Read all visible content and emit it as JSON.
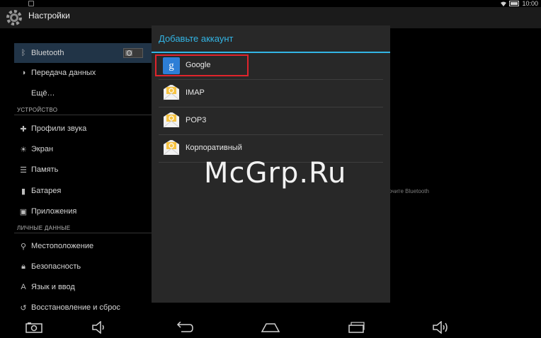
{
  "status_bar": {
    "time": "10:00"
  },
  "app": {
    "title": "Настройки"
  },
  "sidebar": {
    "items": [
      {
        "label": "Bluetooth",
        "icon": "bluetooth-icon",
        "selected": true
      },
      {
        "label": "Передача данных",
        "icon": "data-usage-icon"
      },
      {
        "label": "Ещё…",
        "icon": ""
      },
      {
        "label": "Профили звука",
        "icon": "sound-profile-icon"
      },
      {
        "label": "Экран",
        "icon": "display-icon"
      },
      {
        "label": "Память",
        "icon": "storage-icon"
      },
      {
        "label": "Батарея",
        "icon": "battery-icon"
      },
      {
        "label": "Приложения",
        "icon": "apps-icon"
      },
      {
        "label": "Местоположение",
        "icon": "location-icon"
      },
      {
        "label": "Безопасность",
        "icon": "lock-icon"
      },
      {
        "label": "Язык и ввод",
        "icon": "language-icon"
      },
      {
        "label": "Восстановление и сброс",
        "icon": "restore-icon"
      }
    ],
    "sections": {
      "device": "УСТРОЙСТВО",
      "personal": "ЛИЧНЫЕ ДАННЫЕ"
    }
  },
  "detail": {
    "hint": "очите Bluetooth"
  },
  "dialog": {
    "title": "Добавьте аккаунт",
    "accounts": [
      {
        "label": "Google",
        "icon": "google-icon",
        "highlighted": true
      },
      {
        "label": "IMAP",
        "icon": "email-envelope-icon"
      },
      {
        "label": "POP3",
        "icon": "email-envelope-icon"
      },
      {
        "label": "Корпоративный",
        "icon": "email-envelope-icon"
      }
    ]
  },
  "watermark": "McGrp.Ru",
  "navbar": {
    "buttons": [
      "camera-icon",
      "volume-down-icon",
      "back-icon",
      "home-icon",
      "recent-apps-icon",
      "volume-up-icon"
    ]
  },
  "colors": {
    "accent": "#33b5e5",
    "highlight_border": "#e0242c",
    "selected_bg": "#213447"
  }
}
